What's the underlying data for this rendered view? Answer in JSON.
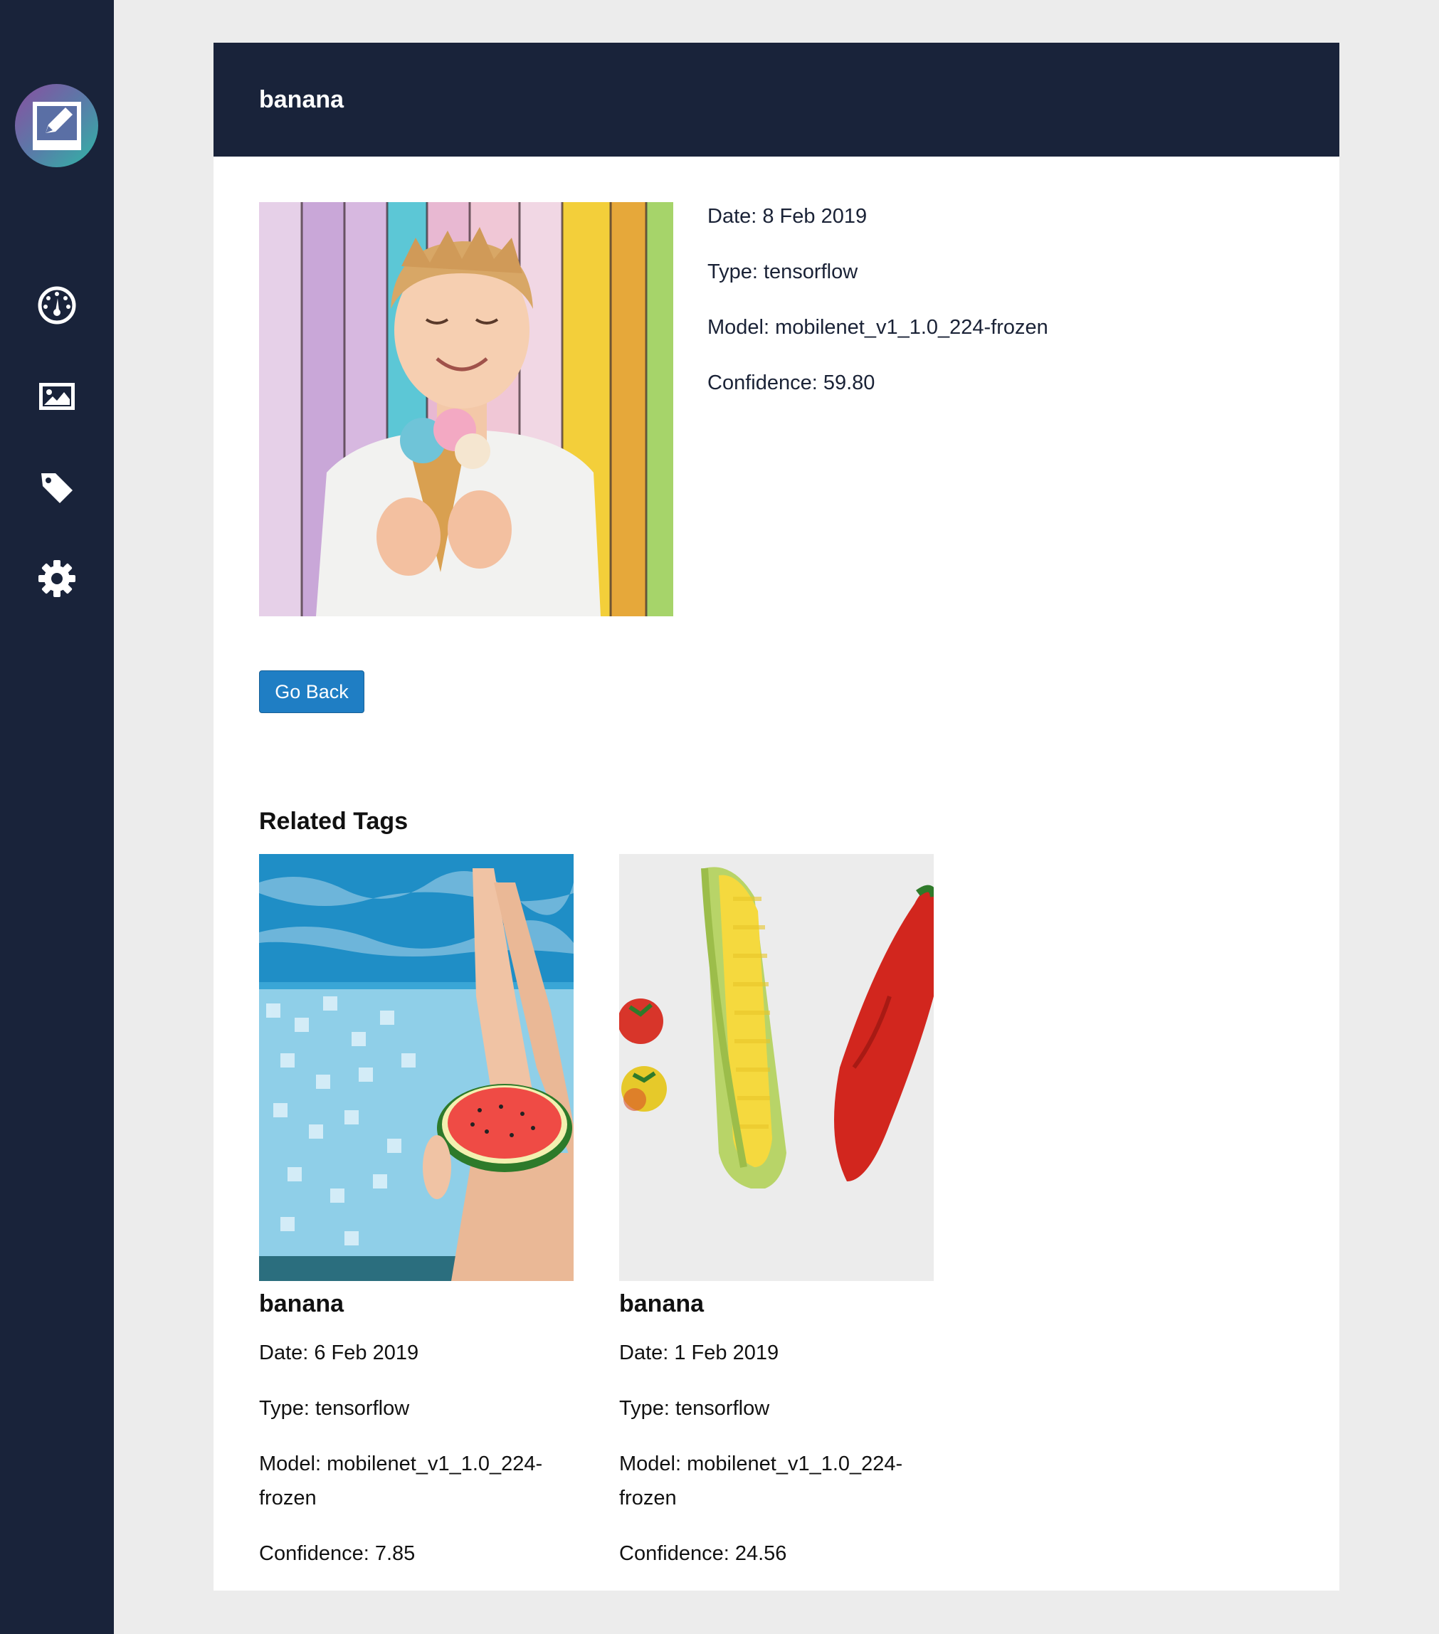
{
  "sidebar": {
    "logo": "image-edit-logo",
    "items": [
      {
        "icon": "dashboard-gauge-icon"
      },
      {
        "icon": "image-icon"
      },
      {
        "icon": "tag-icon"
      },
      {
        "icon": "gear-icon"
      }
    ]
  },
  "header": {
    "title": "banana"
  },
  "detail": {
    "date": "Date: 8 Feb 2019",
    "type": "Type: tensorflow",
    "model": "Model: mobilenet_v1_1.0_224-frozen",
    "confidence": "Confidence: 59.80"
  },
  "go_back_label": "Go Back",
  "related": {
    "title": "Related Tags",
    "items": [
      {
        "name": "banana",
        "date": "Date: 6 Feb 2019",
        "type": "Type: tensorflow",
        "model_line1": "Model: mobilenet_v1_1.0_224-",
        "model_line2": "frozen",
        "confidence": "Confidence: 7.85"
      },
      {
        "name": "banana",
        "date": "Date: 1 Feb 2019",
        "type": "Type: tensorflow",
        "model_line1": "Model: mobilenet_v1_1.0_224-",
        "model_line2": "frozen",
        "confidence": "Confidence: 24.56"
      }
    ]
  },
  "colors": {
    "sidebar": "#19233a",
    "header": "#19233a",
    "button": "#1f7ec4",
    "background": "#ececec"
  }
}
